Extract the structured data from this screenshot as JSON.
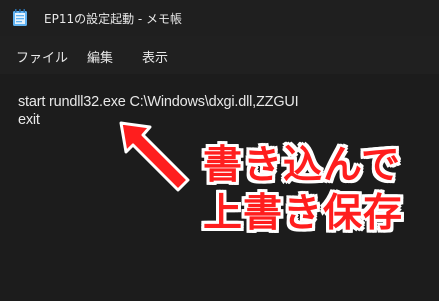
{
  "window": {
    "title": "EP11の設定起動 - メモ帳",
    "icon": "notepad-icon"
  },
  "menu": {
    "items": [
      {
        "label": "ファイル"
      },
      {
        "label": "編集"
      },
      {
        "label": "表示"
      }
    ]
  },
  "editor": {
    "lines": [
      "start rundll32.exe C:\\Windows\\dxgi.dll,ZZGUI",
      "exit"
    ]
  },
  "annotation": {
    "line1": "書き込んで",
    "line2": "上書き保存",
    "color": "#ff1e1e",
    "outline_color": "#ffffff",
    "arrow_icon": "red-arrow-icon"
  }
}
